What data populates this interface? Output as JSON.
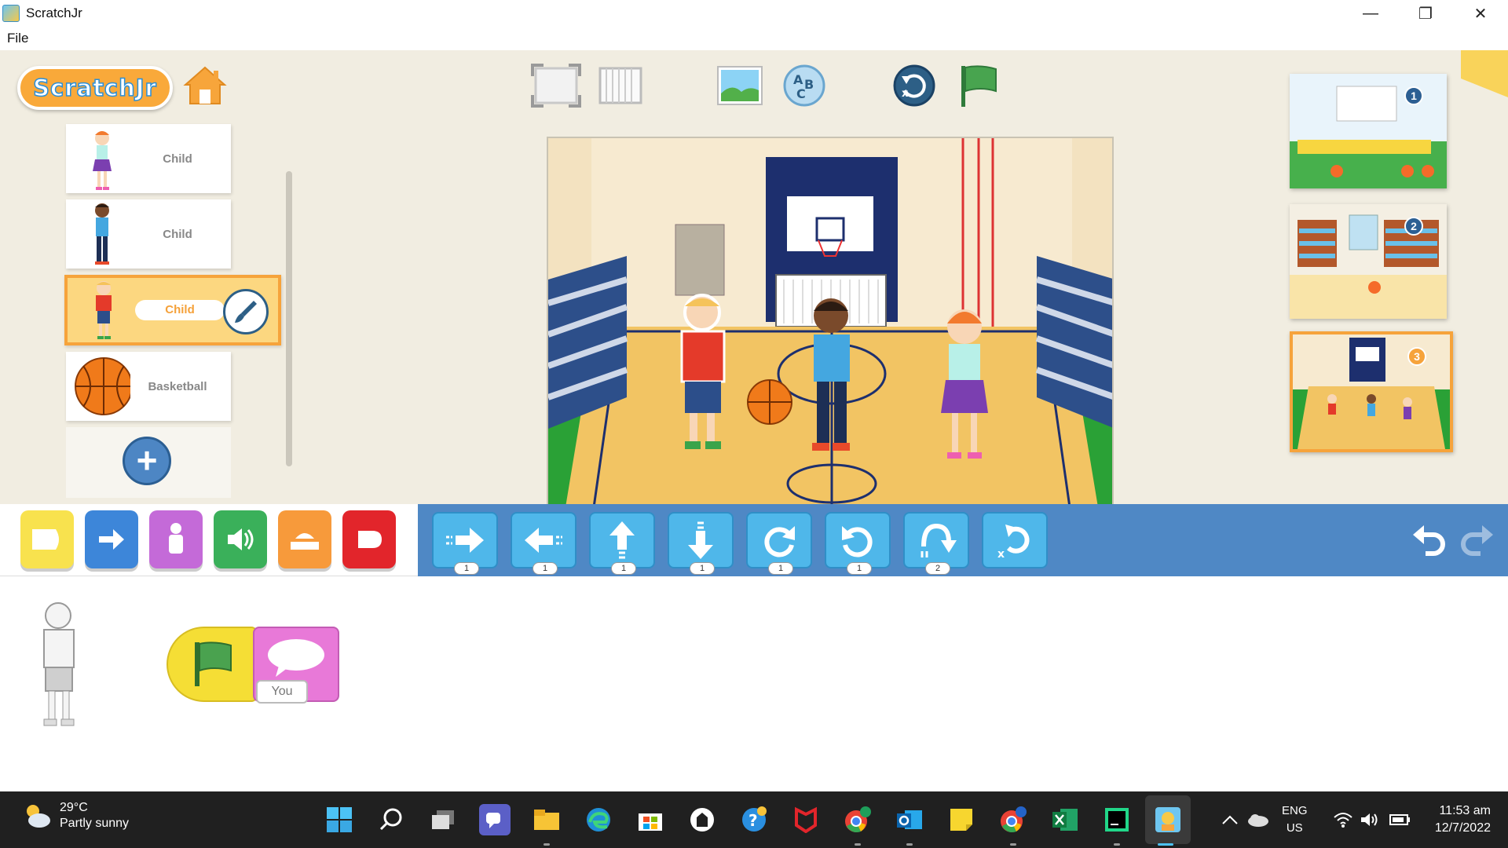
{
  "window": {
    "title": "ScratchJr",
    "minimize": "—",
    "restore": "❐",
    "close": "✕"
  },
  "menu": {
    "file": "File"
  },
  "logo": {
    "text": "ScratchJr"
  },
  "sprites": [
    {
      "label": "Child"
    },
    {
      "label": "Child"
    },
    {
      "label": "Child",
      "selected": true
    },
    {
      "label": "Basketball"
    }
  ],
  "add_sprite_symbol": "+",
  "pages": [
    {
      "number": "1"
    },
    {
      "number": "2"
    },
    {
      "number": "3",
      "selected": true
    }
  ],
  "block_counts": [
    "1",
    "1",
    "1",
    "1",
    "1",
    "1",
    "2"
  ],
  "script": {
    "say_text": "You"
  },
  "taskbar": {
    "temperature": "29°C",
    "condition": "Partly sunny",
    "lang_top": "ENG",
    "lang_bottom": "US",
    "time": "11:53 am",
    "date": "12/7/2022"
  },
  "colors": {
    "accent": "#f6a33b",
    "palette_bar": "#4f88c5",
    "motion_block": "#4fb7ea"
  }
}
